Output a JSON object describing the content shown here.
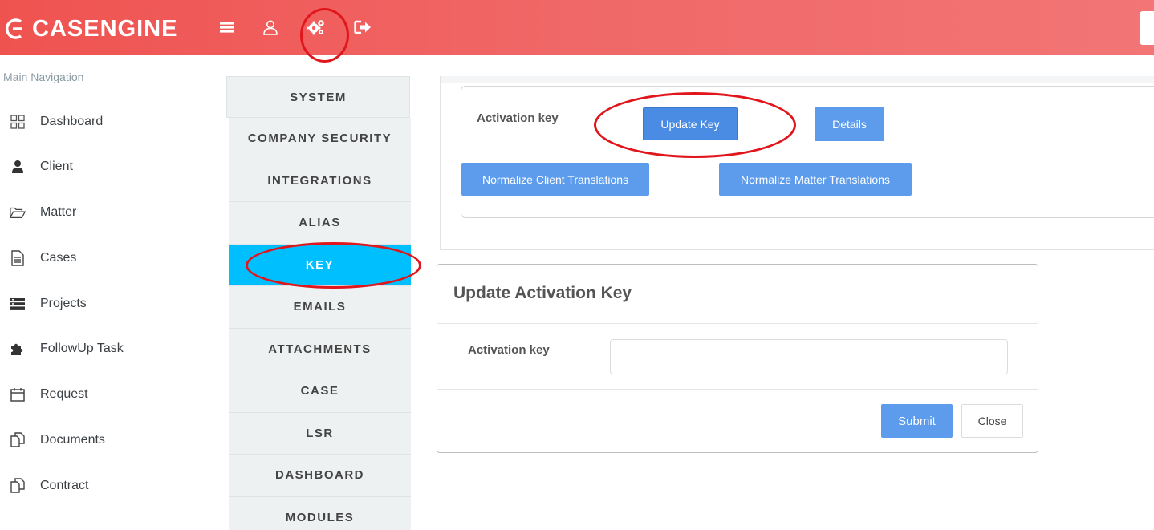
{
  "header": {
    "brand": "CASENGINE",
    "icons": [
      "menu-icon",
      "user-icon",
      "settings-gears-icon",
      "logout-icon"
    ]
  },
  "sidebar": {
    "title": "Main Navigation",
    "items": [
      {
        "label": "Dashboard",
        "icon": "dashboard-grid-icon"
      },
      {
        "label": "Client",
        "icon": "user-icon"
      },
      {
        "label": "Matter",
        "icon": "folder-open-icon"
      },
      {
        "label": "Cases",
        "icon": "document-icon"
      },
      {
        "label": "Projects",
        "icon": "projects-icon"
      },
      {
        "label": "FollowUp Task",
        "icon": "puzzle-icon"
      },
      {
        "label": "Request",
        "icon": "calendar-icon"
      },
      {
        "label": "Documents",
        "icon": "copy-icon"
      },
      {
        "label": "Contract",
        "icon": "copy-icon"
      }
    ]
  },
  "settings_menu": {
    "system": "SYSTEM",
    "items": [
      "COMPANY SECURITY",
      "INTEGRATIONS",
      "ALIAS",
      "KEY",
      "EMAILS",
      "ATTACHMENTS",
      "CASE",
      "LSR",
      "DASHBOARD",
      "MODULES"
    ],
    "active": "KEY"
  },
  "key_panel": {
    "label": "Activation key",
    "update_key": "Update Key",
    "details": "Details",
    "normalize_client": "Normalize Client Translations",
    "normalize_matter": "Normalize Matter Translations"
  },
  "modal": {
    "title": "Update Activation Key",
    "field_label": "Activation key",
    "field_value": "",
    "submit": "Submit",
    "close": "Close"
  },
  "colors": {
    "header_start": "#ef5350",
    "header_end": "#f37575",
    "active_menu": "#00bfff",
    "primary_button": "#5d9cec",
    "annotation_red": "#e0161c"
  }
}
